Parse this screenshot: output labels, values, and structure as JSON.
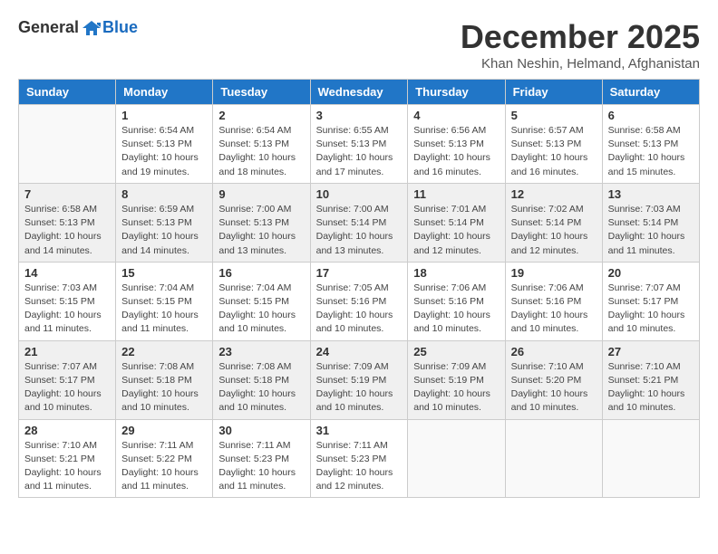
{
  "logo": {
    "general": "General",
    "blue": "Blue"
  },
  "title": "December 2025",
  "location": "Khan Neshin, Helmand, Afghanistan",
  "days_of_week": [
    "Sunday",
    "Monday",
    "Tuesday",
    "Wednesday",
    "Thursday",
    "Friday",
    "Saturday"
  ],
  "weeks": [
    [
      {
        "day": "",
        "sunrise": "",
        "sunset": "",
        "daylight": ""
      },
      {
        "day": "1",
        "sunrise": "Sunrise: 6:54 AM",
        "sunset": "Sunset: 5:13 PM",
        "daylight": "Daylight: 10 hours and 19 minutes."
      },
      {
        "day": "2",
        "sunrise": "Sunrise: 6:54 AM",
        "sunset": "Sunset: 5:13 PM",
        "daylight": "Daylight: 10 hours and 18 minutes."
      },
      {
        "day": "3",
        "sunrise": "Sunrise: 6:55 AM",
        "sunset": "Sunset: 5:13 PM",
        "daylight": "Daylight: 10 hours and 17 minutes."
      },
      {
        "day": "4",
        "sunrise": "Sunrise: 6:56 AM",
        "sunset": "Sunset: 5:13 PM",
        "daylight": "Daylight: 10 hours and 16 minutes."
      },
      {
        "day": "5",
        "sunrise": "Sunrise: 6:57 AM",
        "sunset": "Sunset: 5:13 PM",
        "daylight": "Daylight: 10 hours and 16 minutes."
      },
      {
        "day": "6",
        "sunrise": "Sunrise: 6:58 AM",
        "sunset": "Sunset: 5:13 PM",
        "daylight": "Daylight: 10 hours and 15 minutes."
      }
    ],
    [
      {
        "day": "7",
        "sunrise": "Sunrise: 6:58 AM",
        "sunset": "Sunset: 5:13 PM",
        "daylight": "Daylight: 10 hours and 14 minutes."
      },
      {
        "day": "8",
        "sunrise": "Sunrise: 6:59 AM",
        "sunset": "Sunset: 5:13 PM",
        "daylight": "Daylight: 10 hours and 14 minutes."
      },
      {
        "day": "9",
        "sunrise": "Sunrise: 7:00 AM",
        "sunset": "Sunset: 5:13 PM",
        "daylight": "Daylight: 10 hours and 13 minutes."
      },
      {
        "day": "10",
        "sunrise": "Sunrise: 7:00 AM",
        "sunset": "Sunset: 5:14 PM",
        "daylight": "Daylight: 10 hours and 13 minutes."
      },
      {
        "day": "11",
        "sunrise": "Sunrise: 7:01 AM",
        "sunset": "Sunset: 5:14 PM",
        "daylight": "Daylight: 10 hours and 12 minutes."
      },
      {
        "day": "12",
        "sunrise": "Sunrise: 7:02 AM",
        "sunset": "Sunset: 5:14 PM",
        "daylight": "Daylight: 10 hours and 12 minutes."
      },
      {
        "day": "13",
        "sunrise": "Sunrise: 7:03 AM",
        "sunset": "Sunset: 5:14 PM",
        "daylight": "Daylight: 10 hours and 11 minutes."
      }
    ],
    [
      {
        "day": "14",
        "sunrise": "Sunrise: 7:03 AM",
        "sunset": "Sunset: 5:15 PM",
        "daylight": "Daylight: 10 hours and 11 minutes."
      },
      {
        "day": "15",
        "sunrise": "Sunrise: 7:04 AM",
        "sunset": "Sunset: 5:15 PM",
        "daylight": "Daylight: 10 hours and 11 minutes."
      },
      {
        "day": "16",
        "sunrise": "Sunrise: 7:04 AM",
        "sunset": "Sunset: 5:15 PM",
        "daylight": "Daylight: 10 hours and 10 minutes."
      },
      {
        "day": "17",
        "sunrise": "Sunrise: 7:05 AM",
        "sunset": "Sunset: 5:16 PM",
        "daylight": "Daylight: 10 hours and 10 minutes."
      },
      {
        "day": "18",
        "sunrise": "Sunrise: 7:06 AM",
        "sunset": "Sunset: 5:16 PM",
        "daylight": "Daylight: 10 hours and 10 minutes."
      },
      {
        "day": "19",
        "sunrise": "Sunrise: 7:06 AM",
        "sunset": "Sunset: 5:16 PM",
        "daylight": "Daylight: 10 hours and 10 minutes."
      },
      {
        "day": "20",
        "sunrise": "Sunrise: 7:07 AM",
        "sunset": "Sunset: 5:17 PM",
        "daylight": "Daylight: 10 hours and 10 minutes."
      }
    ],
    [
      {
        "day": "21",
        "sunrise": "Sunrise: 7:07 AM",
        "sunset": "Sunset: 5:17 PM",
        "daylight": "Daylight: 10 hours and 10 minutes."
      },
      {
        "day": "22",
        "sunrise": "Sunrise: 7:08 AM",
        "sunset": "Sunset: 5:18 PM",
        "daylight": "Daylight: 10 hours and 10 minutes."
      },
      {
        "day": "23",
        "sunrise": "Sunrise: 7:08 AM",
        "sunset": "Sunset: 5:18 PM",
        "daylight": "Daylight: 10 hours and 10 minutes."
      },
      {
        "day": "24",
        "sunrise": "Sunrise: 7:09 AM",
        "sunset": "Sunset: 5:19 PM",
        "daylight": "Daylight: 10 hours and 10 minutes."
      },
      {
        "day": "25",
        "sunrise": "Sunrise: 7:09 AM",
        "sunset": "Sunset: 5:19 PM",
        "daylight": "Daylight: 10 hours and 10 minutes."
      },
      {
        "day": "26",
        "sunrise": "Sunrise: 7:10 AM",
        "sunset": "Sunset: 5:20 PM",
        "daylight": "Daylight: 10 hours and 10 minutes."
      },
      {
        "day": "27",
        "sunrise": "Sunrise: 7:10 AM",
        "sunset": "Sunset: 5:21 PM",
        "daylight": "Daylight: 10 hours and 10 minutes."
      }
    ],
    [
      {
        "day": "28",
        "sunrise": "Sunrise: 7:10 AM",
        "sunset": "Sunset: 5:21 PM",
        "daylight": "Daylight: 10 hours and 11 minutes."
      },
      {
        "day": "29",
        "sunrise": "Sunrise: 7:11 AM",
        "sunset": "Sunset: 5:22 PM",
        "daylight": "Daylight: 10 hours and 11 minutes."
      },
      {
        "day": "30",
        "sunrise": "Sunrise: 7:11 AM",
        "sunset": "Sunset: 5:23 PM",
        "daylight": "Daylight: 10 hours and 11 minutes."
      },
      {
        "day": "31",
        "sunrise": "Sunrise: 7:11 AM",
        "sunset": "Sunset: 5:23 PM",
        "daylight": "Daylight: 10 hours and 12 minutes."
      },
      {
        "day": "",
        "sunrise": "",
        "sunset": "",
        "daylight": ""
      },
      {
        "day": "",
        "sunrise": "",
        "sunset": "",
        "daylight": ""
      },
      {
        "day": "",
        "sunrise": "",
        "sunset": "",
        "daylight": ""
      }
    ]
  ]
}
